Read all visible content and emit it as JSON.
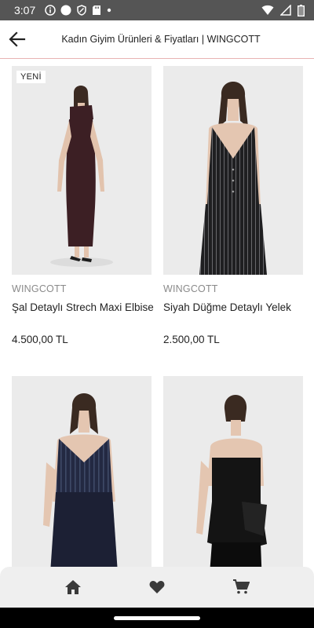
{
  "status_bar": {
    "time": "3:07",
    "left_icons": [
      "info-icon",
      "circle-icon",
      "shield-icon",
      "sd-card-icon",
      "dot-icon"
    ],
    "right_icons": [
      "wifi-icon",
      "signal-icon",
      "battery-icon"
    ]
  },
  "header": {
    "title": "Kadın Giyim Ürünleri & Fiyatları | WINGCOTT",
    "back_icon": "arrow-left-icon"
  },
  "products": [
    {
      "badge": "YENİ",
      "brand": "WINGCOTT",
      "name": "Şal Detaylı Strech Maxi Elbise",
      "price": "4.500,00 TL",
      "image": "model-maroon-maxi-dress"
    },
    {
      "badge": "",
      "brand": "WINGCOTT",
      "name": "Siyah Düğme Detaylı Yelek",
      "price": "2.500,00 TL",
      "image": "model-black-pinstripe-vest"
    },
    {
      "badge": "",
      "brand": "",
      "name": "",
      "price": "",
      "image": "model-navy-pinstripe-vest"
    },
    {
      "badge": "",
      "brand": "",
      "name": "",
      "price": "",
      "image": "model-black-strapless-top"
    }
  ],
  "bottom_nav": {
    "items": [
      {
        "icon": "home-icon"
      },
      {
        "icon": "heart-icon"
      },
      {
        "icon": "cart-icon"
      }
    ]
  },
  "colors": {
    "status_bar": "#555555",
    "divider": "#e8b3b3",
    "image_bg": "#ebebeb",
    "brand_text": "#8a8a8a",
    "nav_bg": "#efefef"
  }
}
